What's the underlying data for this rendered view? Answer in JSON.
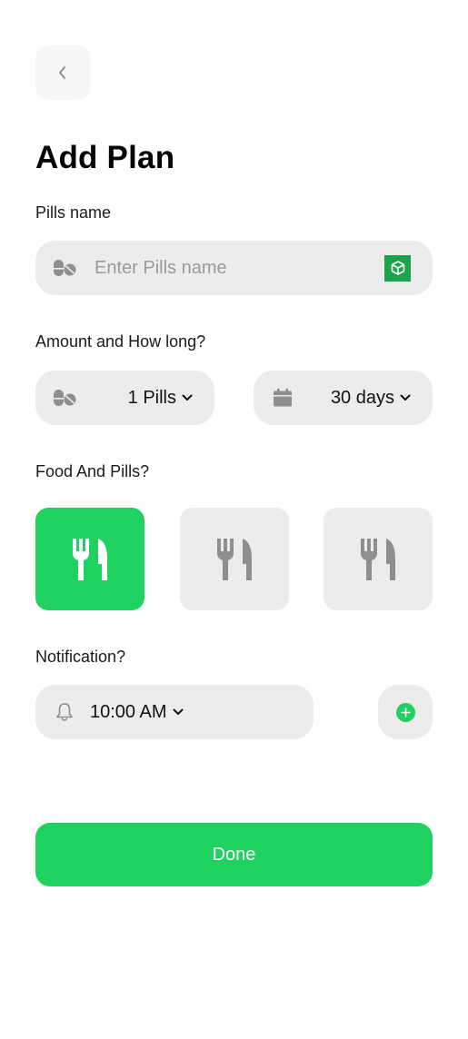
{
  "header": {
    "title": "Add Plan"
  },
  "pills_name": {
    "label": "Pills name",
    "placeholder": "Enter Pills name",
    "value": ""
  },
  "amount": {
    "label": "Amount and How long?",
    "pills_value": "1 Pills",
    "duration_value": "30 days"
  },
  "food": {
    "label": "Food And Pills?",
    "options": [
      {
        "icon": "fork-knife-icon",
        "selected": true
      },
      {
        "icon": "fork-knife-icon",
        "selected": false
      },
      {
        "icon": "fork-knife-icon",
        "selected": false
      }
    ]
  },
  "notification": {
    "label": "Notification?",
    "time_value": "10:00 AM"
  },
  "footer": {
    "done_label": "Done"
  },
  "colors": {
    "accent": "#1fd15f",
    "field_bg": "#ececec",
    "icon_gray": "#8e8e8e",
    "cube_badge": "#1aa34a"
  }
}
